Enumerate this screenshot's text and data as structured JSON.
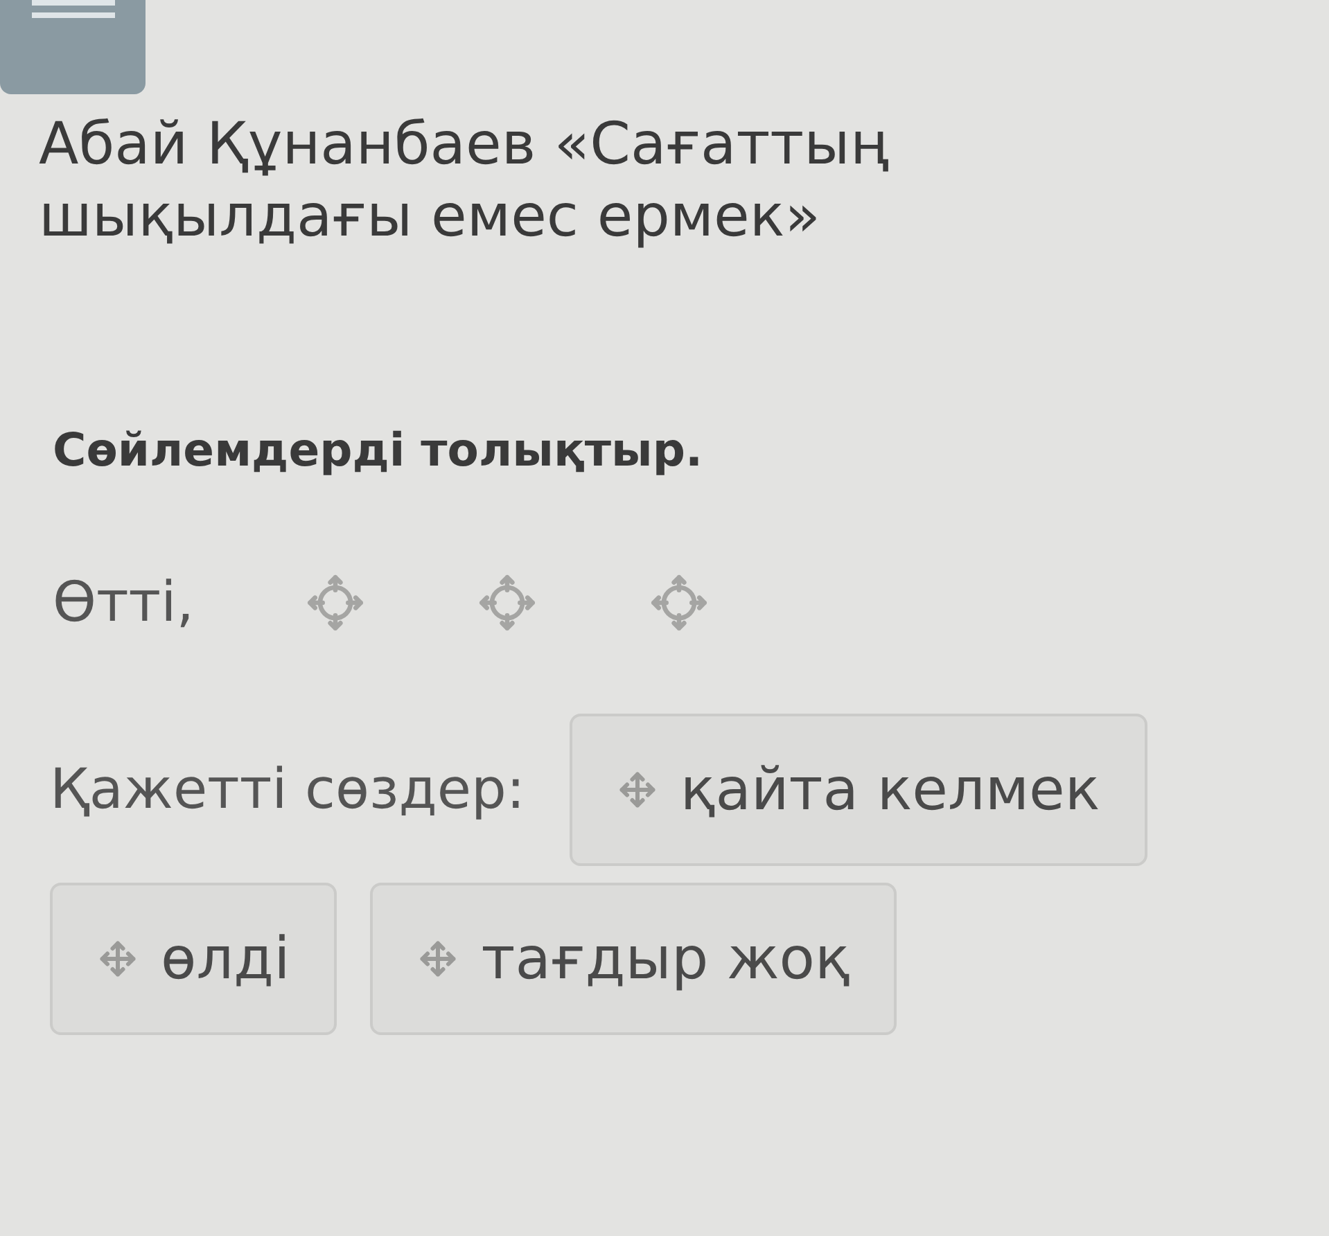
{
  "title": "Абай Құнанбаев «Сағаттың шықылдағы емес ермек»",
  "instruction": "Сөйлемдерді толықтыр.",
  "sentence": {
    "lead": "Өтті,",
    "blanks": [
      {
        "kind": "drop-target"
      },
      {
        "kind": "drop-target"
      },
      {
        "kind": "drop-target"
      }
    ]
  },
  "word_bank": {
    "label": "Қажетті сөздер:",
    "words": [
      {
        "text": "қайта келмек"
      },
      {
        "text": "өлді"
      },
      {
        "text": "тағдыр жоқ"
      }
    ]
  }
}
